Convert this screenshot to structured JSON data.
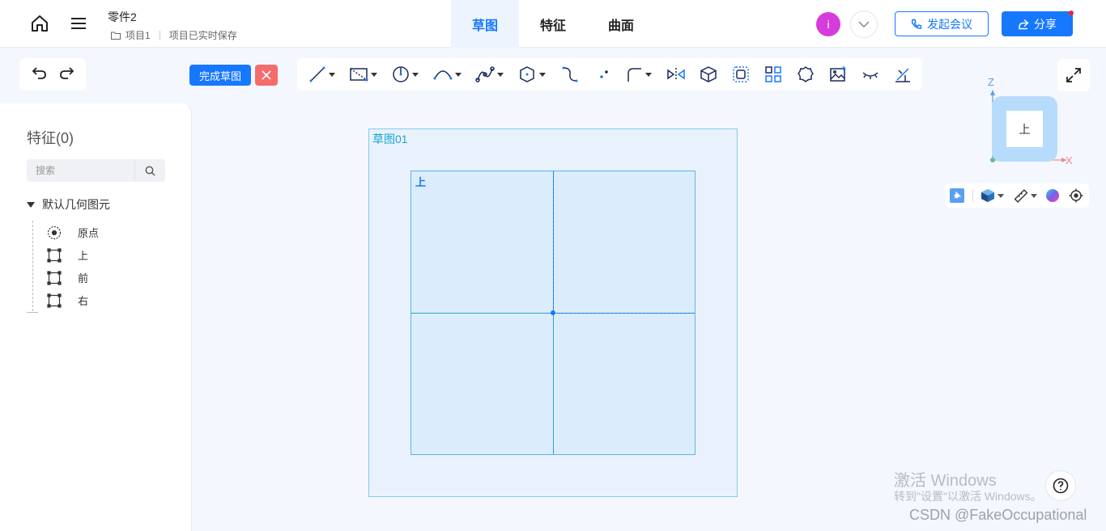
{
  "header": {
    "doc_title": "零件2",
    "project": "项目1",
    "save_status": "项目已实时保存",
    "tabs": [
      {
        "label": "草图",
        "active": true
      },
      {
        "label": "特征",
        "active": false
      },
      {
        "label": "曲面",
        "active": false
      }
    ],
    "avatar_initial": "i",
    "meeting_label": "发起会议",
    "share_label": "分享"
  },
  "toolbar": {
    "finish_label": "完成草图",
    "tools": [
      "line-tool",
      "rectangle-tool",
      "circle-tool",
      "arc-tool",
      "spline-tool",
      "polygon-tool",
      "curve-tool",
      "point-tool",
      "fillet-tool",
      "mirror-tool",
      "extrude-tool",
      "offset-tool",
      "pattern-tool",
      "shape-tool",
      "image-tool",
      "hide-tool",
      "dimension-tool"
    ]
  },
  "panel": {
    "title": "特征(0)",
    "search_placeholder": "搜索",
    "group_label": "默认几何图元",
    "items": [
      {
        "label": "原点",
        "icon": "origin-icon"
      },
      {
        "label": "上",
        "icon": "plane-icon"
      },
      {
        "label": "前",
        "icon": "plane-icon"
      },
      {
        "label": "右",
        "icon": "plane-icon"
      }
    ]
  },
  "canvas": {
    "sketch_label": "草图01",
    "plane_label": "上"
  },
  "viewcube": {
    "face_label": "上",
    "axis_z": "Z",
    "axis_x": "X"
  },
  "watermark": {
    "line1": "激活 Windows",
    "line2": "转到\"设置\"以激活 Windows。",
    "credit": "CSDN @FakeOccupational"
  },
  "colors": {
    "accent": "#1677ff",
    "cancel": "#f56c6c",
    "sketch_border": "#7fcfea",
    "plane_fill": "#dbecfc"
  }
}
